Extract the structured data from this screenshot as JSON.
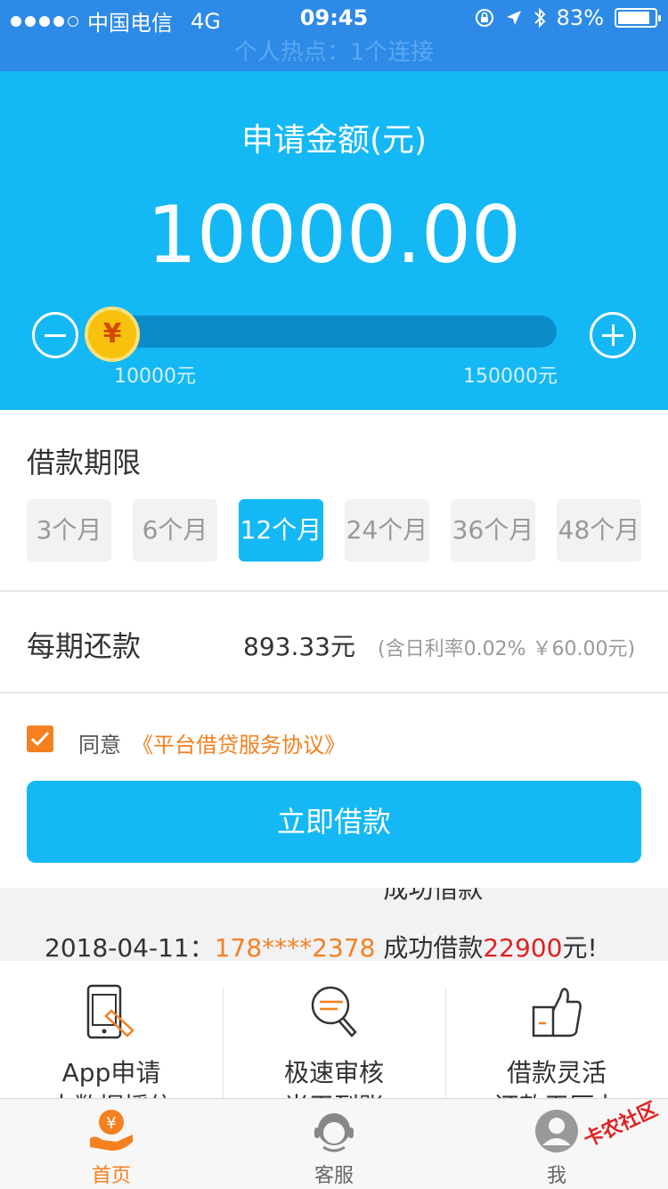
{
  "status_bar": {
    "carrier": "中国电信",
    "network": "4G",
    "time": "09:45",
    "battery": "83%"
  },
  "hotspot": {
    "text": "个人热点：1个连接"
  },
  "hero": {
    "label": "申请金额(元)",
    "amount": "10000.00",
    "min_label": "10000元",
    "max_label": "150000元",
    "slider_fraction": 0,
    "knob_symbol": "¥"
  },
  "term": {
    "title": "借款期限",
    "options": [
      "3个月",
      "6个月",
      "12个月",
      "24个月",
      "36个月",
      "48个月"
    ],
    "selected": "12个月"
  },
  "repayment": {
    "label": "每期还款",
    "amount": "893.33元",
    "note": "(含日利率0.02% ￥60.00元)"
  },
  "agreement": {
    "checked": true,
    "text": "同意",
    "link": "《平台借贷服务协议》"
  },
  "borrow_button": {
    "label": "立即借款"
  },
  "ticker": {
    "prev_line": "成功借款",
    "date": "2018-04-11：",
    "phone": "178****2378",
    "text": "成功借款",
    "amount": "22900",
    "suffix": "元!"
  },
  "features": [
    {
      "icon": "phone-apply-icon",
      "title": "App申请",
      "subtitle": "大数据授信"
    },
    {
      "icon": "magnifier-review-icon",
      "title": "极速审核",
      "subtitle": "当天到账"
    },
    {
      "icon": "thumbs-up-icon",
      "title": "借款灵活",
      "subtitle": "还款无压力"
    }
  ],
  "tabs": [
    {
      "icon": "home-icon",
      "label": "首页",
      "active": true
    },
    {
      "icon": "customer-service-icon",
      "label": "客服",
      "active": false
    },
    {
      "icon": "user-icon",
      "label": "我",
      "active": false
    }
  ],
  "watermark": "卡农社区",
  "colors": {
    "primary": "#14b8f5",
    "accent": "#f5801f",
    "status_bar": "#2d8ae6",
    "highlight_red": "#e02020"
  }
}
